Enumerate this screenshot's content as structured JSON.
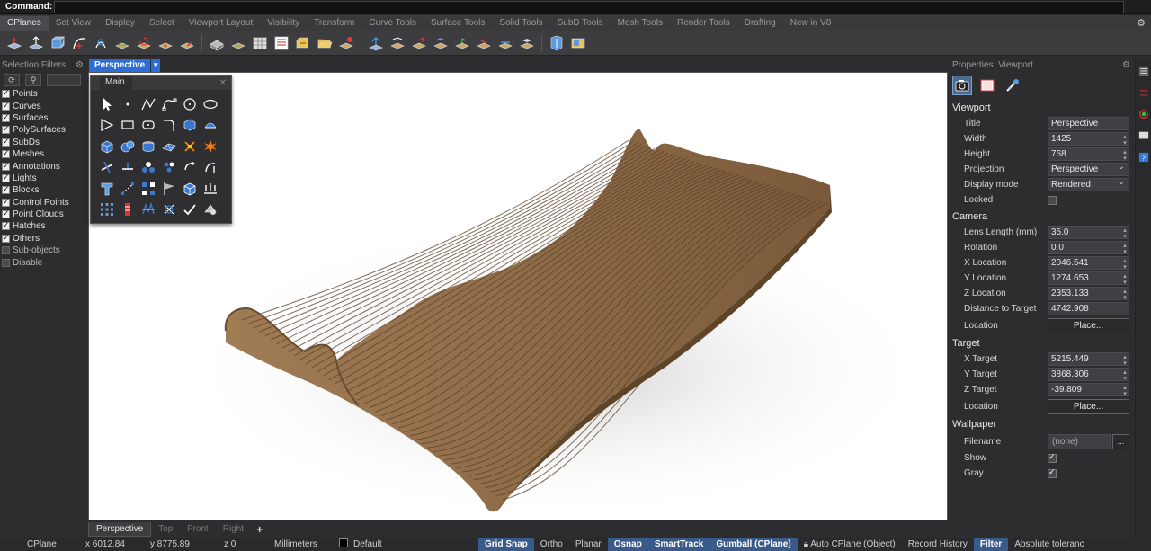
{
  "command": {
    "label": "Command:",
    "value": ""
  },
  "tabs": [
    "CPlanes",
    "Set View",
    "Display",
    "Select",
    "Viewport Layout",
    "Visibility",
    "Transform",
    "Curve Tools",
    "Surface Tools",
    "Solid Tools",
    "SubD Tools",
    "Mesh Tools",
    "Render Tools",
    "Drafting",
    "New in V8"
  ],
  "active_tab": "CPlanes",
  "selection_filters": {
    "title": "Selection Filters",
    "items": [
      {
        "label": "Points",
        "checked": true
      },
      {
        "label": "Curves",
        "checked": true
      },
      {
        "label": "Surfaces",
        "checked": true
      },
      {
        "label": "PolySurfaces",
        "checked": true
      },
      {
        "label": "SubDs",
        "checked": true
      },
      {
        "label": "Meshes",
        "checked": true
      },
      {
        "label": "Annotations",
        "checked": true
      },
      {
        "label": "Lights",
        "checked": true
      },
      {
        "label": "Blocks",
        "checked": true
      },
      {
        "label": "Control Points",
        "checked": true
      },
      {
        "label": "Point Clouds",
        "checked": true
      },
      {
        "label": "Hatches",
        "checked": true
      },
      {
        "label": "Others",
        "checked": true
      },
      {
        "label": "Sub-objects",
        "checked": false
      },
      {
        "label": "Disable",
        "checked": false
      }
    ]
  },
  "viewport": {
    "title": "Perspective"
  },
  "main_panel": {
    "tab": "Main",
    "close": "✕"
  },
  "viewport_tabs": [
    "Perspective",
    "Top",
    "Front",
    "Right"
  ],
  "viewport_add": "+",
  "properties": {
    "header": "Properties: Viewport",
    "viewport_section": "Viewport",
    "title_label": "Title",
    "title_value": "Perspective",
    "width_label": "Width",
    "width_value": "1425",
    "height_label": "Height",
    "height_value": "768",
    "projection_label": "Projection",
    "projection_value": "Perspective",
    "display_label": "Display mode",
    "display_value": "Rendered",
    "locked_label": "Locked",
    "camera_section": "Camera",
    "lens_label": "Lens Length (mm)",
    "lens_value": "35.0",
    "rotation_label": "Rotation",
    "rotation_value": "0.0",
    "xloc_label": "X Location",
    "xloc_value": "2046.541",
    "yloc_label": "Y Location",
    "yloc_value": "1274.653",
    "zloc_label": "Z Location",
    "zloc_value": "2353.133",
    "dist_label": "Distance to Target",
    "dist_value": "4742.908",
    "location_label": "Location",
    "place_button": "Place...",
    "target_section": "Target",
    "xt_label": "X Target",
    "xt_value": "5215.449",
    "yt_label": "Y Target",
    "yt_value": "3868.306",
    "zt_label": "Z Target",
    "zt_value": "-39.809",
    "tlocation_label": "Location",
    "tplace_button": "Place...",
    "wallpaper_section": "Wallpaper",
    "filename_label": "Filename",
    "filename_value": "(none)",
    "browse_button": "...",
    "show_label": "Show",
    "gray_label": "Gray"
  },
  "status": {
    "cplane": "CPlane",
    "x": "x 6012.84",
    "y": "y 8775.89",
    "z": "z 0",
    "units": "Millimeters",
    "layer": "Default",
    "grid_snap": "Grid Snap",
    "ortho": "Ortho",
    "planar": "Planar",
    "osnap": "Osnap",
    "smarttrack": "SmartTrack",
    "gumball": "Gumball (CPlane)",
    "auto_cplane": "Auto CPlane (Object)",
    "record_history": "Record History",
    "filter": "Filter",
    "tolerance": "Absolute toleranc"
  },
  "colors": {
    "accent": "#2c6ed5",
    "wood": "#8b6a47",
    "status_highlight": "#3a5a8a"
  }
}
